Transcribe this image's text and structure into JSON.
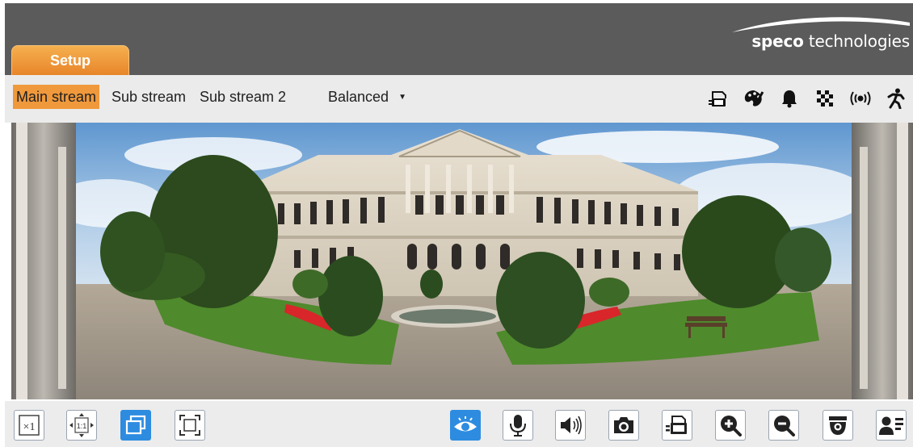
{
  "header": {
    "setup_tab_label": "Setup",
    "brand_bold": "speco",
    "brand_rest": " technologies",
    "bg_color": "#5b5b5b",
    "tab_color": "#f0993c"
  },
  "stream_bar": {
    "tabs": [
      {
        "label": "Main stream",
        "active": true
      },
      {
        "label": "Sub stream",
        "active": false
      },
      {
        "label": "Sub stream 2",
        "active": false
      }
    ],
    "quality_selected": "Balanced",
    "status_icons": [
      "sd-card-icon",
      "palette-icon",
      "alarm-bell-icon",
      "mosaic-icon",
      "audio-alarm-icon",
      "motion-person-icon"
    ]
  },
  "video": {
    "content": "live-camera-view"
  },
  "toolbar": {
    "left_buttons": [
      {
        "name": "original-size-button",
        "label": "×1"
      },
      {
        "name": "fit-ratio-button",
        "label": "1:1"
      },
      {
        "name": "window-mode-button",
        "active": true
      },
      {
        "name": "fullscreen-button"
      }
    ],
    "right_buttons": [
      "live-view-button",
      "microphone-button",
      "speaker-button",
      "snapshot-button",
      "record-button",
      "zoom-in-button",
      "zoom-out-button",
      "ptz-dome-button",
      "face-detect-button"
    ],
    "active_color": "#2d8ce0"
  }
}
